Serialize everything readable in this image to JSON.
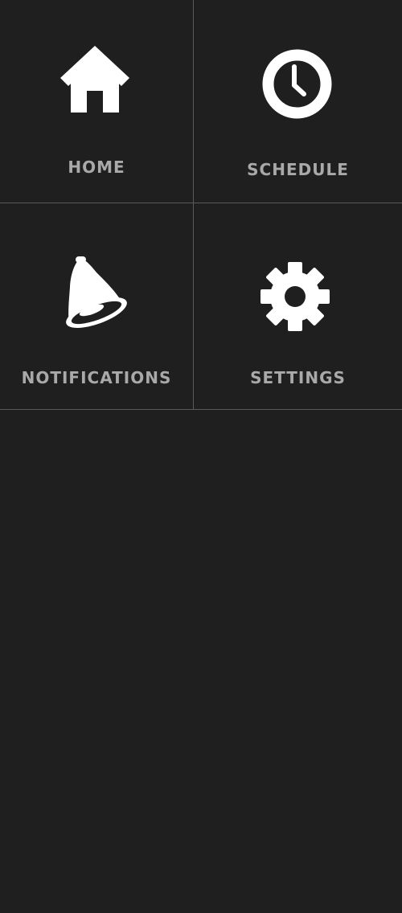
{
  "menu": {
    "home": {
      "label": "HOME",
      "icon": "home-icon"
    },
    "schedule": {
      "label": "SCHEDULE",
      "icon": "clock-icon"
    },
    "notifications": {
      "label": "NOTIFICATIONS",
      "icon": "bell-icon"
    },
    "settings": {
      "label": "SETTINGS",
      "icon": "gear-icon"
    }
  },
  "colors": {
    "background": "#1f1f1f",
    "icon": "#ffffff",
    "label": "#a9a9a9",
    "divider": "#5a5a5a"
  }
}
